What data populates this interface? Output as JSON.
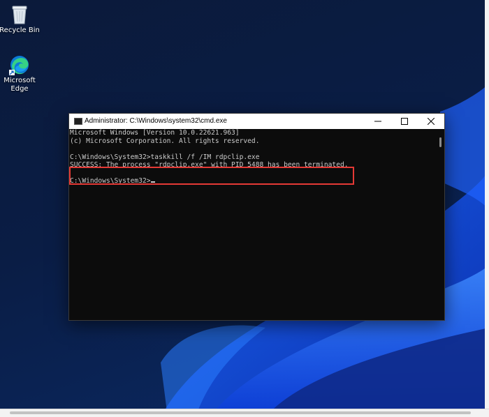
{
  "desktop": {
    "icons": [
      {
        "label": "Recycle Bin",
        "icon": "recycle-bin-icon"
      },
      {
        "label_line1": "Microsoft",
        "label_line2": "Edge",
        "icon": "edge-icon"
      }
    ]
  },
  "window": {
    "title": "Administrator: C:\\Windows\\system32\\cmd.exe",
    "icon": "cmd-icon",
    "controls": {
      "minimize": "minimize-icon",
      "maximize": "maximize-icon",
      "close": "close-icon"
    }
  },
  "console": {
    "lines": [
      "Microsoft Windows [Version 10.0.22621.963]",
      "(c) Microsoft Corporation. All rights reserved.",
      "",
      "C:\\Windows\\System32>taskkill /f /IM rdpclip.exe",
      "SUCCESS: The process \"rdpclip.exe\" with PID 5488 has been terminated.",
      "",
      "C:\\Windows\\System32>"
    ],
    "highlight_color": "#e53935"
  },
  "colors": {
    "console_bg": "#0c0c0c",
    "console_text": "#cccccc",
    "wallpaper_accent": "#1a5cff"
  }
}
